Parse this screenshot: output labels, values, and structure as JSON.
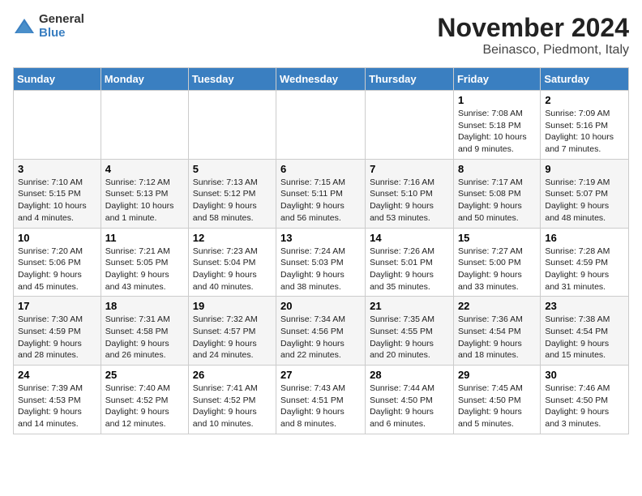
{
  "logo": {
    "general": "General",
    "blue": "Blue"
  },
  "header": {
    "month": "November 2024",
    "location": "Beinasco, Piedmont, Italy"
  },
  "columns": [
    "Sunday",
    "Monday",
    "Tuesday",
    "Wednesday",
    "Thursday",
    "Friday",
    "Saturday"
  ],
  "weeks": [
    [
      {
        "day": "",
        "info": ""
      },
      {
        "day": "",
        "info": ""
      },
      {
        "day": "",
        "info": ""
      },
      {
        "day": "",
        "info": ""
      },
      {
        "day": "",
        "info": ""
      },
      {
        "day": "1",
        "info": "Sunrise: 7:08 AM\nSunset: 5:18 PM\nDaylight: 10 hours and 9 minutes."
      },
      {
        "day": "2",
        "info": "Sunrise: 7:09 AM\nSunset: 5:16 PM\nDaylight: 10 hours and 7 minutes."
      }
    ],
    [
      {
        "day": "3",
        "info": "Sunrise: 7:10 AM\nSunset: 5:15 PM\nDaylight: 10 hours and 4 minutes."
      },
      {
        "day": "4",
        "info": "Sunrise: 7:12 AM\nSunset: 5:13 PM\nDaylight: 10 hours and 1 minute."
      },
      {
        "day": "5",
        "info": "Sunrise: 7:13 AM\nSunset: 5:12 PM\nDaylight: 9 hours and 58 minutes."
      },
      {
        "day": "6",
        "info": "Sunrise: 7:15 AM\nSunset: 5:11 PM\nDaylight: 9 hours and 56 minutes."
      },
      {
        "day": "7",
        "info": "Sunrise: 7:16 AM\nSunset: 5:10 PM\nDaylight: 9 hours and 53 minutes."
      },
      {
        "day": "8",
        "info": "Sunrise: 7:17 AM\nSunset: 5:08 PM\nDaylight: 9 hours and 50 minutes."
      },
      {
        "day": "9",
        "info": "Sunrise: 7:19 AM\nSunset: 5:07 PM\nDaylight: 9 hours and 48 minutes."
      }
    ],
    [
      {
        "day": "10",
        "info": "Sunrise: 7:20 AM\nSunset: 5:06 PM\nDaylight: 9 hours and 45 minutes."
      },
      {
        "day": "11",
        "info": "Sunrise: 7:21 AM\nSunset: 5:05 PM\nDaylight: 9 hours and 43 minutes."
      },
      {
        "day": "12",
        "info": "Sunrise: 7:23 AM\nSunset: 5:04 PM\nDaylight: 9 hours and 40 minutes."
      },
      {
        "day": "13",
        "info": "Sunrise: 7:24 AM\nSunset: 5:03 PM\nDaylight: 9 hours and 38 minutes."
      },
      {
        "day": "14",
        "info": "Sunrise: 7:26 AM\nSunset: 5:01 PM\nDaylight: 9 hours and 35 minutes."
      },
      {
        "day": "15",
        "info": "Sunrise: 7:27 AM\nSunset: 5:00 PM\nDaylight: 9 hours and 33 minutes."
      },
      {
        "day": "16",
        "info": "Sunrise: 7:28 AM\nSunset: 4:59 PM\nDaylight: 9 hours and 31 minutes."
      }
    ],
    [
      {
        "day": "17",
        "info": "Sunrise: 7:30 AM\nSunset: 4:59 PM\nDaylight: 9 hours and 28 minutes."
      },
      {
        "day": "18",
        "info": "Sunrise: 7:31 AM\nSunset: 4:58 PM\nDaylight: 9 hours and 26 minutes."
      },
      {
        "day": "19",
        "info": "Sunrise: 7:32 AM\nSunset: 4:57 PM\nDaylight: 9 hours and 24 minutes."
      },
      {
        "day": "20",
        "info": "Sunrise: 7:34 AM\nSunset: 4:56 PM\nDaylight: 9 hours and 22 minutes."
      },
      {
        "day": "21",
        "info": "Sunrise: 7:35 AM\nSunset: 4:55 PM\nDaylight: 9 hours and 20 minutes."
      },
      {
        "day": "22",
        "info": "Sunrise: 7:36 AM\nSunset: 4:54 PM\nDaylight: 9 hours and 18 minutes."
      },
      {
        "day": "23",
        "info": "Sunrise: 7:38 AM\nSunset: 4:54 PM\nDaylight: 9 hours and 15 minutes."
      }
    ],
    [
      {
        "day": "24",
        "info": "Sunrise: 7:39 AM\nSunset: 4:53 PM\nDaylight: 9 hours and 14 minutes."
      },
      {
        "day": "25",
        "info": "Sunrise: 7:40 AM\nSunset: 4:52 PM\nDaylight: 9 hours and 12 minutes."
      },
      {
        "day": "26",
        "info": "Sunrise: 7:41 AM\nSunset: 4:52 PM\nDaylight: 9 hours and 10 minutes."
      },
      {
        "day": "27",
        "info": "Sunrise: 7:43 AM\nSunset: 4:51 PM\nDaylight: 9 hours and 8 minutes."
      },
      {
        "day": "28",
        "info": "Sunrise: 7:44 AM\nSunset: 4:50 PM\nDaylight: 9 hours and 6 minutes."
      },
      {
        "day": "29",
        "info": "Sunrise: 7:45 AM\nSunset: 4:50 PM\nDaylight: 9 hours and 5 minutes."
      },
      {
        "day": "30",
        "info": "Sunrise: 7:46 AM\nSunset: 4:50 PM\nDaylight: 9 hours and 3 minutes."
      }
    ]
  ]
}
